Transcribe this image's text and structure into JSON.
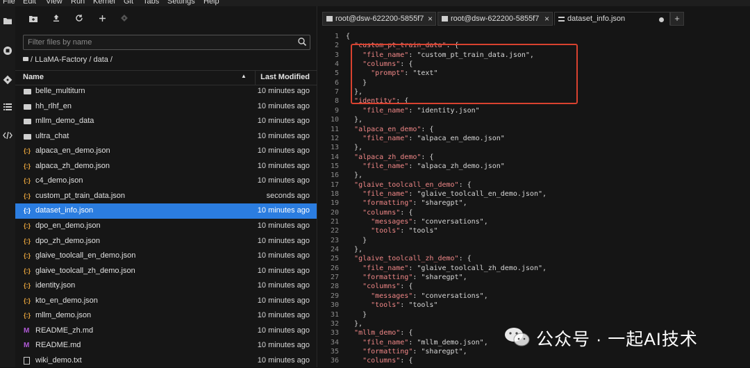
{
  "menu": [
    "File",
    "Edit",
    "View",
    "Run",
    "Kernel",
    "Git",
    "Tabs",
    "Settings",
    "Help"
  ],
  "activity_icons": [
    "folder-icon",
    "stop-circle-icon",
    "git-icon",
    "list-icon",
    "code-icon"
  ],
  "toolbar_icons": [
    "new-folder-icon",
    "upload-icon",
    "refresh-icon",
    "plus-icon",
    "git-clone-icon"
  ],
  "filter": {
    "placeholder": "Filter files by name"
  },
  "breadcrumb": "/ LLaMA-Factory / data /",
  "columns": {
    "name": "Name",
    "modified": "Last Modified"
  },
  "files": [
    {
      "name": "belle_multiturn",
      "modified": "10 minutes ago",
      "type": "folder"
    },
    {
      "name": "hh_rlhf_en",
      "modified": "10 minutes ago",
      "type": "folder"
    },
    {
      "name": "mllm_demo_data",
      "modified": "10 minutes ago",
      "type": "folder"
    },
    {
      "name": "ultra_chat",
      "modified": "10 minutes ago",
      "type": "folder"
    },
    {
      "name": "alpaca_en_demo.json",
      "modified": "10 minutes ago",
      "type": "json"
    },
    {
      "name": "alpaca_zh_demo.json",
      "modified": "10 minutes ago",
      "type": "json"
    },
    {
      "name": "c4_demo.json",
      "modified": "10 minutes ago",
      "type": "json"
    },
    {
      "name": "custom_pt_train_data.json",
      "modified": "seconds ago",
      "type": "json"
    },
    {
      "name": "dataset_info.json",
      "modified": "10 minutes ago",
      "type": "json",
      "selected": true
    },
    {
      "name": "dpo_en_demo.json",
      "modified": "10 minutes ago",
      "type": "json"
    },
    {
      "name": "dpo_zh_demo.json",
      "modified": "10 minutes ago",
      "type": "json"
    },
    {
      "name": "glaive_toolcall_en_demo.json",
      "modified": "10 minutes ago",
      "type": "json"
    },
    {
      "name": "glaive_toolcall_zh_demo.json",
      "modified": "10 minutes ago",
      "type": "json"
    },
    {
      "name": "identity.json",
      "modified": "10 minutes ago",
      "type": "json"
    },
    {
      "name": "kto_en_demo.json",
      "modified": "10 minutes ago",
      "type": "json"
    },
    {
      "name": "mllm_demo.json",
      "modified": "10 minutes ago",
      "type": "json"
    },
    {
      "name": "README_zh.md",
      "modified": "10 minutes ago",
      "type": "md"
    },
    {
      "name": "README.md",
      "modified": "10 minutes ago",
      "type": "md"
    },
    {
      "name": "wiki_demo.txt",
      "modified": "10 minutes ago",
      "type": "txt"
    }
  ],
  "tabs": [
    {
      "label": "root@dsw-622200-5855f7",
      "type": "terminal"
    },
    {
      "label": "root@dsw-622200-5855f7",
      "type": "terminal"
    },
    {
      "label": "dataset_info.json",
      "type": "editor",
      "active": true
    }
  ],
  "code_lines": [
    "{",
    "  \"custom_pt_train_data\": {",
    "    \"file_name\": \"custom_pt_train_data.json\",",
    "    \"columns\": {",
    "      \"prompt\": \"text\"",
    "    }",
    "  },",
    "  \"identity\": {",
    "    \"file_name\": \"identity.json\"",
    "  },",
    "  \"alpaca_en_demo\": {",
    "    \"file_name\": \"alpaca_en_demo.json\"",
    "  },",
    "  \"alpaca_zh_demo\": {",
    "    \"file_name\": \"alpaca_zh_demo.json\"",
    "  },",
    "  \"glaive_toolcall_en_demo\": {",
    "    \"file_name\": \"glaive_toolcall_en_demo.json\",",
    "    \"formatting\": \"sharegpt\",",
    "    \"columns\": {",
    "      \"messages\": \"conversations\",",
    "      \"tools\": \"tools\"",
    "    }",
    "  },",
    "  \"glaive_toolcall_zh_demo\": {",
    "    \"file_name\": \"glaive_toolcall_zh_demo.json\",",
    "    \"formatting\": \"sharegpt\",",
    "    \"columns\": {",
    "      \"messages\": \"conversations\",",
    "      \"tools\": \"tools\"",
    "    }",
    "  },",
    "  \"mllm_demo\": {",
    "    \"file_name\": \"mllm_demo.json\",",
    "    \"formatting\": \"sharegpt\",",
    "    \"columns\": {"
  ],
  "watermark": "公众号 · 一起AI技术",
  "colors": {
    "selection": "#2b7de0",
    "highlight_box": "#d9422f",
    "json_key": "#f08787",
    "json_icon": "#e8a43c",
    "md_icon": "#b05ad6"
  }
}
